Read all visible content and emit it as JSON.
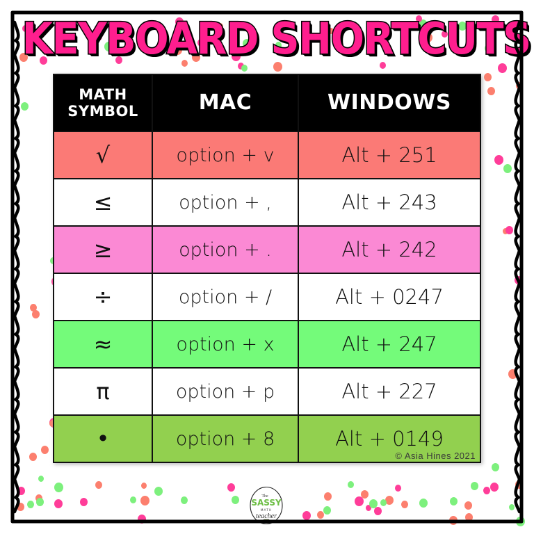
{
  "page": {
    "title": "KEYBOARD SHORTCUTS",
    "background_color": "#FFFFFF",
    "title_fill_color": "#FF1E8E",
    "title_outline_color": "#000000"
  },
  "table": {
    "header_background": "#000000",
    "header_text_color": "#FFFFFF",
    "columns": [
      {
        "label": "MATH\nSYMBOL",
        "line1": "MATH",
        "line2": "SYMBOL"
      },
      {
        "label": "MAC"
      },
      {
        "label": "WINDOWS"
      }
    ],
    "rows": [
      {
        "symbol": "√",
        "symbol_name": "square-root",
        "mac": "option + v",
        "windows": "Alt + 251",
        "row_color": "#FB7A76"
      },
      {
        "symbol": "≤",
        "symbol_name": "less-than-or-equal",
        "mac": "option + ,",
        "windows": "Alt + 243",
        "row_color": "#FFFFFF"
      },
      {
        "symbol": "≥",
        "symbol_name": "greater-than-or-equal",
        "mac": "option + .",
        "windows": "Alt + 242",
        "row_color": "#FB89D4"
      },
      {
        "symbol": "÷",
        "symbol_name": "division-sign",
        "mac": "option + /",
        "windows": "Alt + 0247",
        "row_color": "#FFFFFF"
      },
      {
        "symbol": "≈",
        "symbol_name": "approximately-equal",
        "mac": "option + x",
        "windows": "Alt + 247",
        "row_color": "#74FB7A"
      },
      {
        "symbol": "π",
        "symbol_name": "pi",
        "mac": "option + p",
        "windows": "Alt + 227",
        "row_color": "#FFFFFF"
      },
      {
        "symbol": "•",
        "symbol_name": "bullet-dot",
        "mac": "option + 8",
        "windows": "Alt + 0149",
        "row_color": "#92D04F"
      }
    ],
    "copyright": "© Asia Hines 2021"
  },
  "logo": {
    "line_the": "The",
    "line_sassy": "SASSY",
    "line_math": "MATH",
    "line_teacher": "teacher"
  },
  "decor": {
    "dot_colors": [
      "#FF3D99",
      "#7DF07D",
      "#FC7F6E"
    ],
    "frame_color": "#000000"
  }
}
